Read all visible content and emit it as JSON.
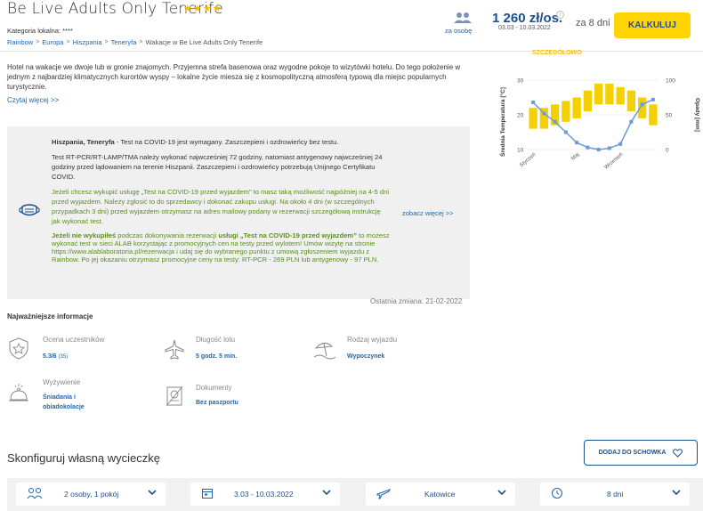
{
  "header": {
    "hotel_name": "Be Live Adults Only Tenerife",
    "stars": "★★★★",
    "category_label": "Kategoria lokalna: ****",
    "breadcrumb": [
      "Rainbow",
      "Europa",
      "Hiszpania",
      "Teneryfa",
      "Wakacje w Be Live Adults Only Tenerife"
    ],
    "per_person_label": "za osobę",
    "price": "1 260 zł/os.",
    "price_dates": "03.03 - 10.03.2022",
    "days_for": "za 8 dni",
    "calc_button": "KALKULUJ"
  },
  "description": {
    "text": "Hotel na wakacje we dwoje lub w gronie znajomych. Przyjemna strefa basenowa oraz wygodne pokoje to wizytówki hotelu. Do tego położenie w jednym z najbardziej klimatycznych kurortów wyspy – lokalne życie miesza się z kosmopolityczną atmosferą typową dla miejsc popularnych turystycznie.",
    "read_more": "Czytaj więcej >>"
  },
  "covid": {
    "heading_bold": "Hiszpania, Teneryfa",
    "heading_rest": " - Test na COVID-19 jest wymagany. Zaszczepieni i ozdrowieńcy bez testu.",
    "para2": "Test RT-PCR/RT-LAMP/TMA należy wykonać najwcześniej 72 godziny, natomiast antygenowy najwcześniej 24 godziny przed lądowaniem na terenie Hiszpanii. Zaszczepieni i ozdrowieńcy potrzebują Unijnego Certyfikatu COVID.",
    "para3": "Jeżeli chcesz wykupić usługę „Test na COVID-19 przed wyjazdem” to masz taką możliwość najpóźniej na 4-5 dni przed wyjazdem. Należy zgłosić to do sprzedawcy i dokonać zakupu usługi. Na około 4 dni (w szczególnych przypadkach 3 dni) przed wyjazdem otrzymasz na adres mailowy podany w rezerwacji szczegółową instrukcję jak wykonać test.",
    "para4_bold1": "Jeżeli nie wykupiłeś",
    "para4_mid": " podczas dokonywania rezerwacji ",
    "para4_bold2": "usługi „Test na COVID-19 przed wyjazdem”",
    "para4_rest": " to możesz wykonać test w sieci ALAB korzystając z promocyjnych cen na testy przed wylotem! Umów wizytę na stronie https://www.alablaboratoria.pl/rezerwacja i udaj się do wybranego punktu z umową zgłoszeniem wyjazdu z Rainbow. Po jej okazaniu otrzymasz promocyjne ceny na testy: RT-PCR - 269 PLN lub antygenowy - 97 PLN.",
    "see_more": "zobacz więcej >>",
    "last_change": "Ostatnia zmiana: 21-02-2022"
  },
  "key_info": {
    "title": "Najważniejsze informacje",
    "rating_label": "Ocena uczestników",
    "rating_value": "5.3/6",
    "rating_count": "(35)",
    "flight_label": "Długość lotu",
    "flight_value": "5 godz. 5 min.",
    "trip_label": "Rodzaj wyjazdu",
    "trip_value": "Wypoczynek",
    "food_label": "Wyżywienie",
    "food_value_1": "Śniadania i",
    "food_value_2": "obiadokolacje",
    "docs_label": "Dokumenty",
    "docs_value": "Bez paszportu"
  },
  "configure": {
    "title": "Skonfiguruj własną wycieczkę",
    "clipboard_button": "DODAJ DO SCHOWKA",
    "persons": "2 osoby, 1 pokój",
    "dates": "3.03 - 10.03.2022",
    "departure": "Katowice",
    "duration": "8 dni"
  },
  "chart_data": {
    "type": "bar+line",
    "title": "SZCZEGÓŁOWO",
    "ylabel_left": "Średnia Temperatura [°C]",
    "ylabel_right": "Opady [mm]",
    "y_left_ticks": [
      "10",
      "20",
      "30"
    ],
    "y_right_ticks": [
      "0",
      "50",
      "100"
    ],
    "x_tick_labels": [
      "Styczeń",
      "Maj",
      "Wrzesień"
    ],
    "bar_color": "#f5d000",
    "line_color": "#6b9bd8",
    "temperature_ranges": [
      [
        16,
        22
      ],
      [
        16,
        22
      ],
      [
        17,
        23
      ],
      [
        18,
        24
      ],
      [
        19,
        25
      ],
      [
        21,
        27
      ],
      [
        23,
        29
      ],
      [
        23,
        29
      ],
      [
        23,
        28
      ],
      [
        21,
        27
      ],
      [
        19,
        25
      ],
      [
        17,
        23
      ]
    ],
    "precipitation": [
      68,
      52,
      40,
      25,
      10,
      3,
      0,
      2,
      8,
      40,
      65,
      72
    ]
  },
  "colors": {
    "brand_blue": "#1c4f8f",
    "link_blue": "#1c67b3",
    "accent_yellow": "#ffd400",
    "covid_green": "#5a8f1e"
  }
}
